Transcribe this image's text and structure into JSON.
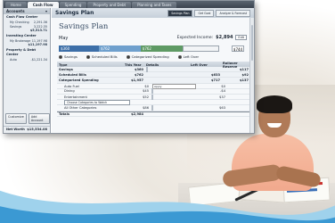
{
  "tabs": [
    "Home",
    "Cash Flow",
    "Spending",
    "Property and Debt",
    "Planning and Taxes"
  ],
  "sidebar": {
    "header": "Accounts",
    "header_action": "",
    "groups": [
      {
        "title": "Cash Flow Center",
        "rows": [
          {
            "label": "My Checking",
            "value": "2,291.36"
          },
          {
            "label": "Savings",
            "value": "3,222.35"
          },
          {
            "label": "",
            "value": "$5,513.71"
          }
        ]
      },
      {
        "title": "Investing Center",
        "rows": [
          {
            "label": "My Brokerage",
            "value": "11,197.98"
          },
          {
            "label": "",
            "value": "$11,197.98"
          }
        ]
      },
      {
        "title": "Property & Debt Center",
        "rows": [
          {
            "label": "Auto",
            "value": "-$1,221.34"
          }
        ]
      }
    ],
    "btn_customize": "Customize",
    "btn_add": "Add Account",
    "net_worth_label": "Net Worth",
    "net_worth_value": "$15,534.08"
  },
  "main": {
    "title": "Savings Plan",
    "header_tabs": [
      "Savings Plan",
      "Get Goal",
      "Analyze & Forecast"
    ],
    "plan_title": "Savings Plan",
    "month": "May",
    "expected_income_label": "Expected Income:",
    "expected_income_value": "$2,894",
    "edit_label": "Edit",
    "bar": {
      "segments": [
        {
          "label": "$360",
          "fraction": 0.25,
          "color": "#3d6fa8"
        },
        {
          "label": "$762",
          "fraction": 0.26,
          "color": "#6fa0cd"
        },
        {
          "label": "$762",
          "fraction": 0.26,
          "color": "#5e9a64"
        },
        {
          "label": "",
          "fraction": 0.23,
          "color": "#f2f4f6"
        }
      ],
      "total_label": "$744"
    },
    "legend": [
      "Savings",
      "Scheduled Bills",
      "Categorized Spending",
      "Left Over"
    ],
    "table": {
      "headers": [
        "Type",
        "This Year",
        "Details",
        "Left Over",
        "Rollover Reserve"
      ],
      "rows": [
        {
          "kind": "group",
          "cells": [
            "Savings",
            "$360",
            "",
            "",
            "$117"
          ],
          "progress": 0.5
        },
        {
          "kind": "group",
          "cells": [
            "Scheduled Bills",
            "$762",
            "",
            "$633",
            "$92"
          ],
          "progress": 0
        },
        {
          "kind": "group",
          "cells": [
            "Categorized Spending",
            "$1,957",
            "",
            "$717",
            "$137"
          ],
          "progress": 0
        },
        {
          "kind": "sub",
          "cells": [
            "Auto Fuel",
            "$0",
            "Apply",
            "$0",
            "$0"
          ],
          "progress": 0
        },
        {
          "kind": "sub",
          "cells": [
            "Dining",
            "$45",
            "",
            "-$4",
            "$0"
          ],
          "progress": 0.85
        },
        {
          "kind": "sub",
          "cells": [
            "Entertainment",
            "$52",
            "",
            "$37",
            "$0"
          ],
          "progress": 0.35
        },
        {
          "kind": "sub",
          "cells": [
            "Choose Categories to Watch",
            "",
            "",
            "",
            ""
          ],
          "progress": 0
        },
        {
          "kind": "sub",
          "cells": [
            "All Other Categories",
            "$86",
            "",
            "$63",
            "$0"
          ],
          "progress": 0.6
        },
        {
          "kind": "total",
          "cells": [
            "Totals",
            "$2,984",
            "",
            "",
            ""
          ],
          "progress": 0
        }
      ]
    }
  }
}
